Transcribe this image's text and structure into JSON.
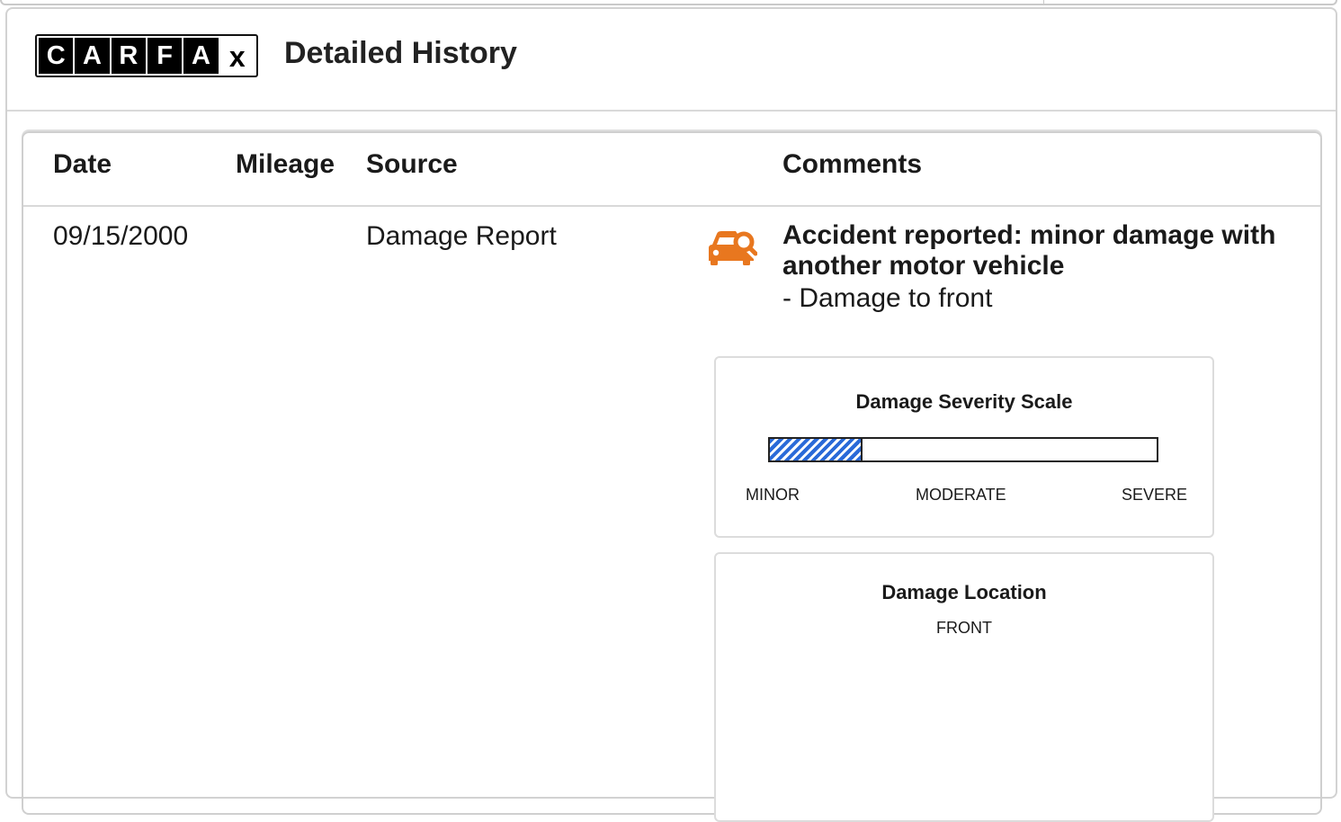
{
  "brand": {
    "logo_letters": [
      "C",
      "A",
      "R",
      "F",
      "A",
      "x"
    ]
  },
  "header": {
    "title": "Detailed History"
  },
  "table": {
    "columns": [
      "Date",
      "Mileage",
      "Source",
      "Comments"
    ],
    "rows": [
      {
        "date": "09/15/2000",
        "mileage": "",
        "source": "Damage Report",
        "icon": "car-damage-search-icon",
        "comment_title": "Accident reported: minor damage with another motor vehicle",
        "comment_detail": "- Damage to front"
      }
    ]
  },
  "severity": {
    "title": "Damage Severity Scale",
    "labels": [
      "MINOR",
      "MODERATE",
      "SEVERE"
    ],
    "level_fraction": 0.24,
    "fill_color": "#2a6ad8"
  },
  "location": {
    "title": "Damage Location",
    "value": "FRONT"
  },
  "colors": {
    "icon_orange": "#e8771f",
    "severity_blue": "#2a6ad8"
  }
}
